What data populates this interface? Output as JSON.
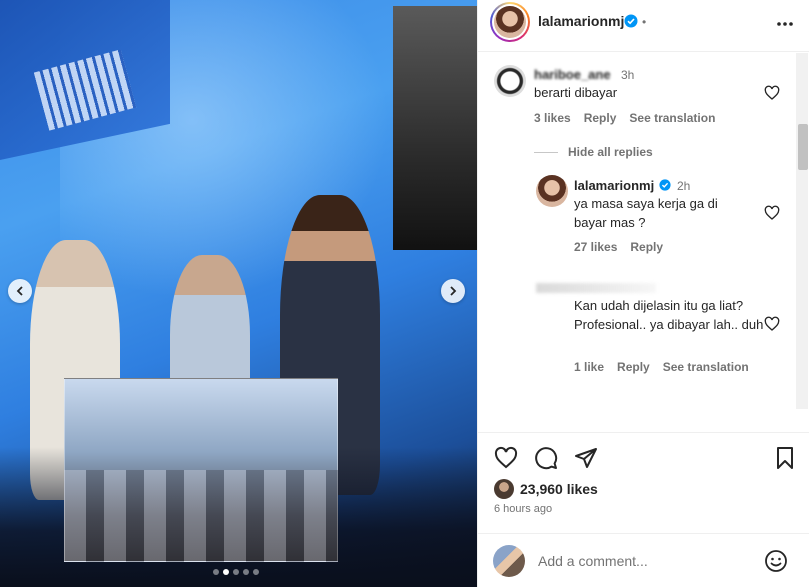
{
  "post": {
    "author": "lalamarionmj",
    "header_separator": "•",
    "likes_count": "23,960 likes",
    "posted_ago": "6 hours ago",
    "carousel": {
      "slide_count": 5,
      "active_index": 1
    }
  },
  "comments": [
    {
      "name": "hariboe_ane",
      "time": "3h",
      "text": "berarti dibayar",
      "likes": "3 likes",
      "reply_label": "Reply",
      "translate_label": "See translation"
    }
  ],
  "hide_replies_label": "Hide all replies",
  "replies": [
    {
      "name": "lalamarionmj",
      "time": "2h",
      "text": "ya masa saya kerja ga di bayar mas ?",
      "likes": "27 likes",
      "reply_label": "Reply"
    },
    {
      "name": "",
      "time": "",
      "text": "Kan udah dijelasin itu ga liat? Profesional.. ya dibayar lah.. duh",
      "likes": "1 like",
      "reply_label": "Reply",
      "translate_label": "See translation"
    }
  ],
  "add_comment": {
    "placeholder": "Add a comment..."
  },
  "icons": {
    "like": "heart-icon",
    "comment": "comment-icon",
    "share": "paper-plane-icon",
    "save": "bookmark-icon",
    "verified": "verified-badge-icon",
    "emoji": "smiley-icon",
    "more": "more-horizontal-icon"
  },
  "colors": {
    "verified": "#0095f6",
    "text": "#262626",
    "muted": "#737373"
  }
}
